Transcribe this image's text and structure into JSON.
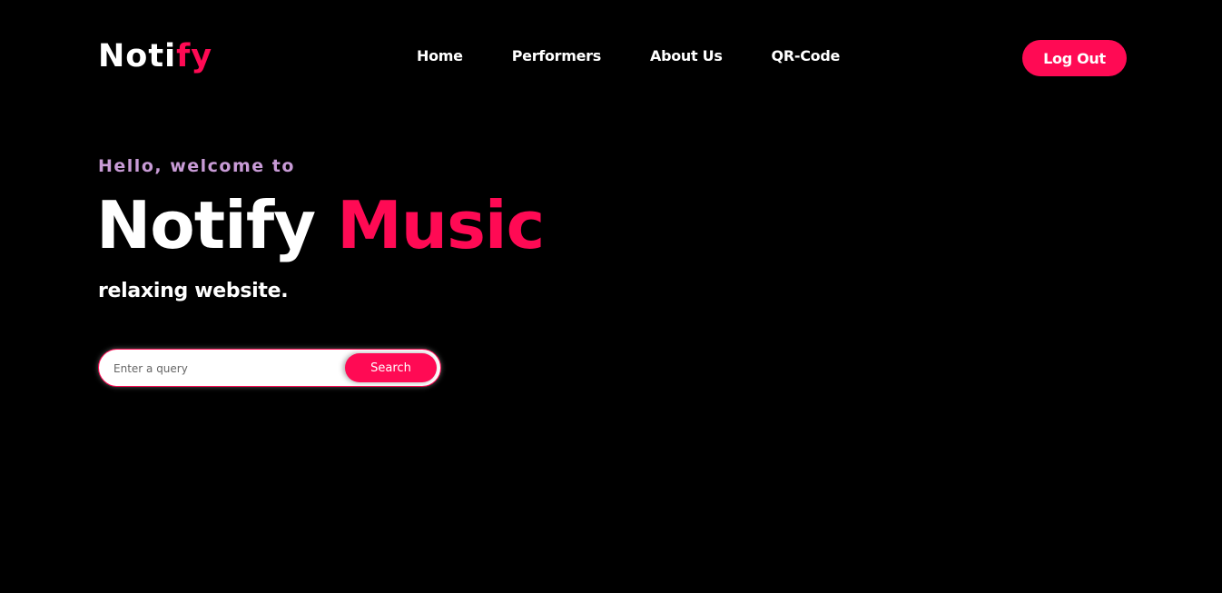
{
  "header": {
    "logo_part1": "Noti",
    "logo_part2": "fy",
    "nav": [
      {
        "label": "Home"
      },
      {
        "label": "Performers"
      },
      {
        "label": "About Us"
      },
      {
        "label": "QR-Code"
      }
    ],
    "logout_label": "Log Out"
  },
  "hero": {
    "welcome": "Hello, welcome to",
    "title_part1": "Notify",
    "title_part2": "Music",
    "tagline": "relaxing website."
  },
  "search": {
    "placeholder": "Enter a query",
    "value": "",
    "button_label": "Search"
  },
  "colors": {
    "background": "#000000",
    "accent": "#ff0a54",
    "welcome": "#c89bd6",
    "text": "#ffffff"
  }
}
